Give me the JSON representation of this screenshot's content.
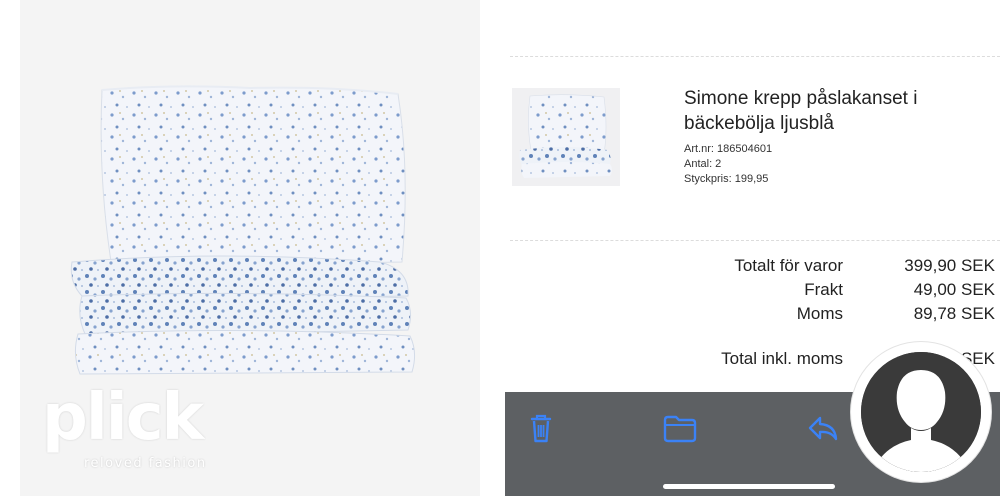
{
  "watermark": {
    "brand": "plick",
    "tagline": "reloved fashion"
  },
  "product": {
    "title": "Simone krepp påslakanset i bäckebölja ljusblå",
    "article_nr": "Art.nr: 186504601",
    "quantity": "Antal: 2",
    "unit_price": "Styckpris: 199,95"
  },
  "totals": {
    "rows": [
      {
        "label": "Totalt för varor",
        "value": "399,90 SEK"
      },
      {
        "label": "Frakt",
        "value": "49,00 SEK"
      },
      {
        "label": "Moms",
        "value": "89,78 SEK"
      }
    ],
    "grand": {
      "label": "Total inkl. moms",
      "value": "SEK"
    }
  },
  "toolbar": {
    "icons": [
      "trash-icon",
      "folder-icon",
      "reply-icon"
    ],
    "accent": "#3b82f6",
    "background": "#5d6063"
  },
  "colors": {
    "pattern_blue": "#6f8fc0",
    "fabric": "#f3f5fa"
  }
}
